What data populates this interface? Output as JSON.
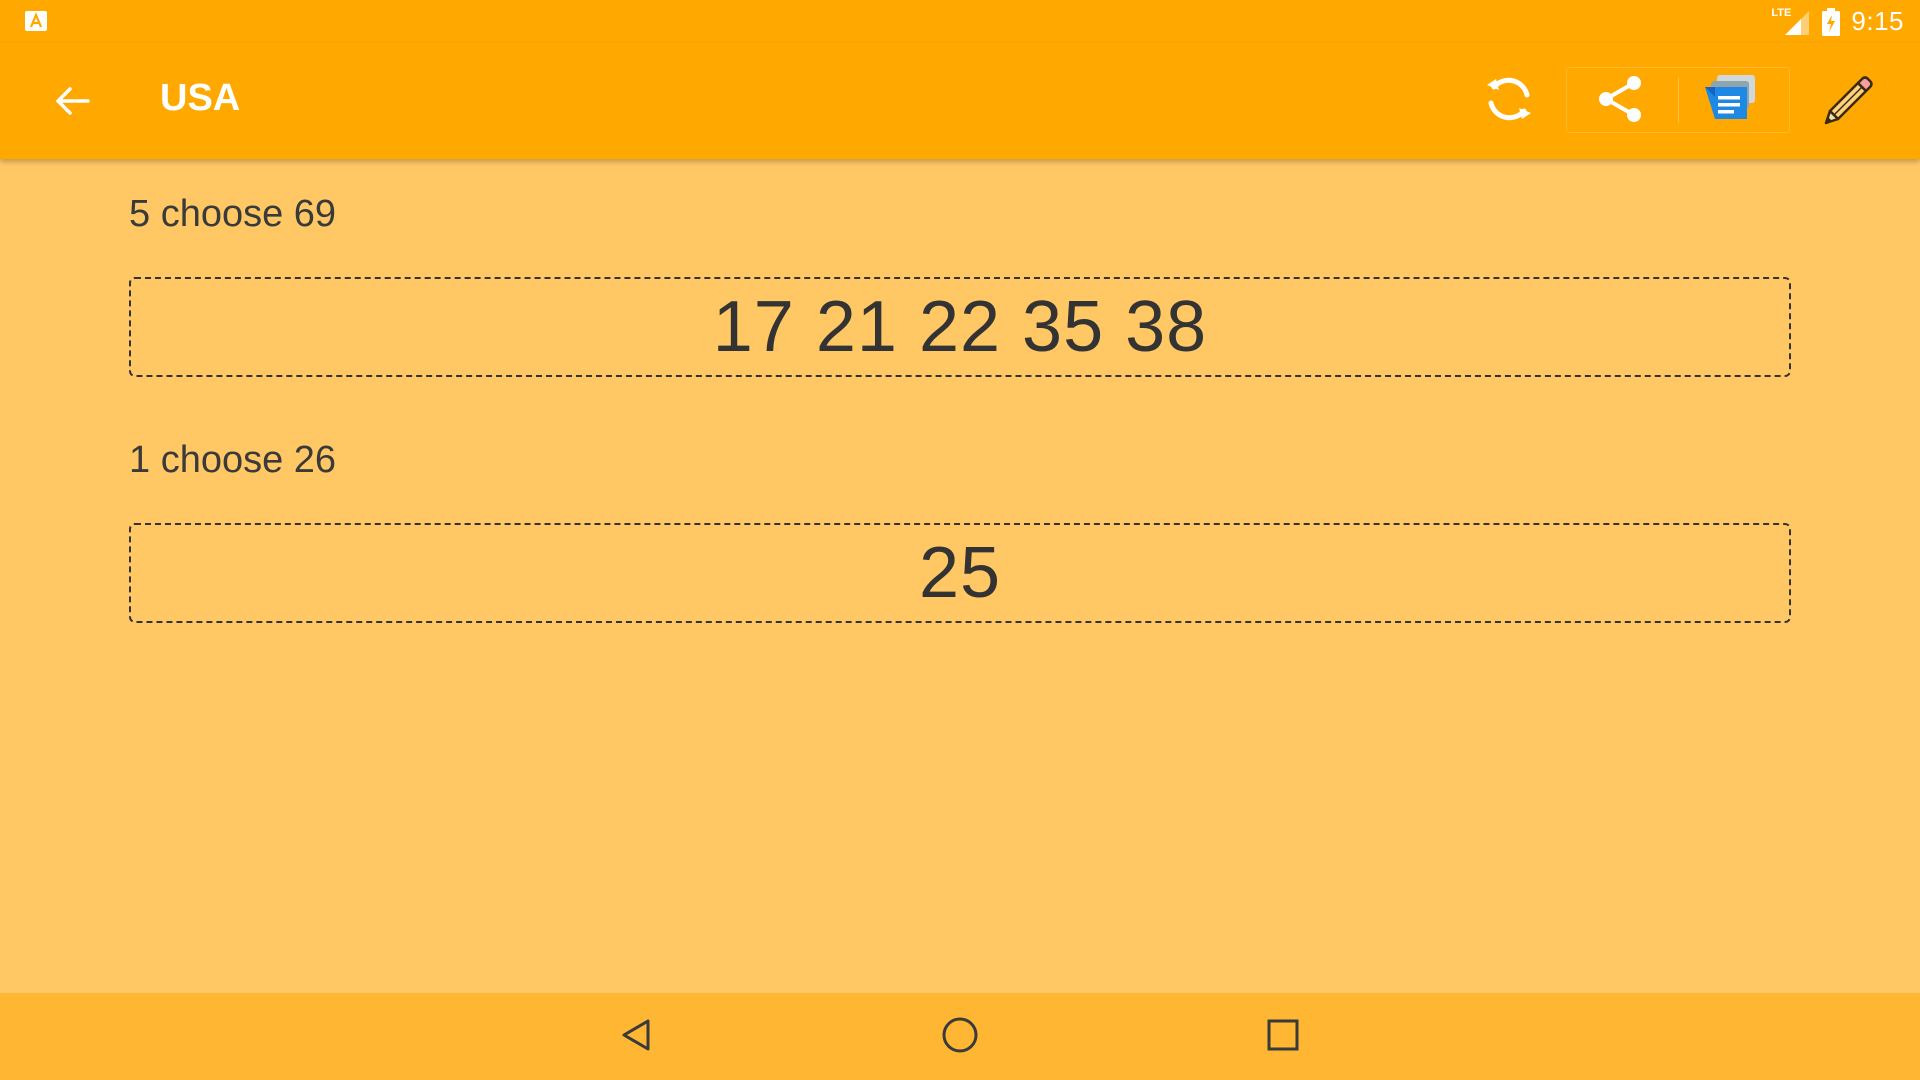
{
  "status_bar": {
    "time": "9:15",
    "network": "LTE",
    "notification_icon": "app-notification-icon",
    "signal_icon": "signal-icon",
    "battery_icon": "battery-charging-icon"
  },
  "app_bar": {
    "title": "USA",
    "back_icon": "arrow-left-icon",
    "actions": [
      "refresh-icon",
      "share-icon",
      "message-icon",
      "pencil-icon"
    ]
  },
  "draws": [
    {
      "label": "5 choose 69",
      "numbers": "17 21 22 35 38"
    },
    {
      "label": "1 choose 26",
      "numbers": "25"
    }
  ],
  "nav_bar": {
    "icons": [
      "nav-back-icon",
      "nav-home-icon",
      "nav-recents-icon"
    ]
  },
  "colors": {
    "app_bar": "#FFA800",
    "background": "#FFC864",
    "nav_bar": "#FFB733",
    "text": "#333333",
    "message_icon_blue": "#1E88E5"
  }
}
